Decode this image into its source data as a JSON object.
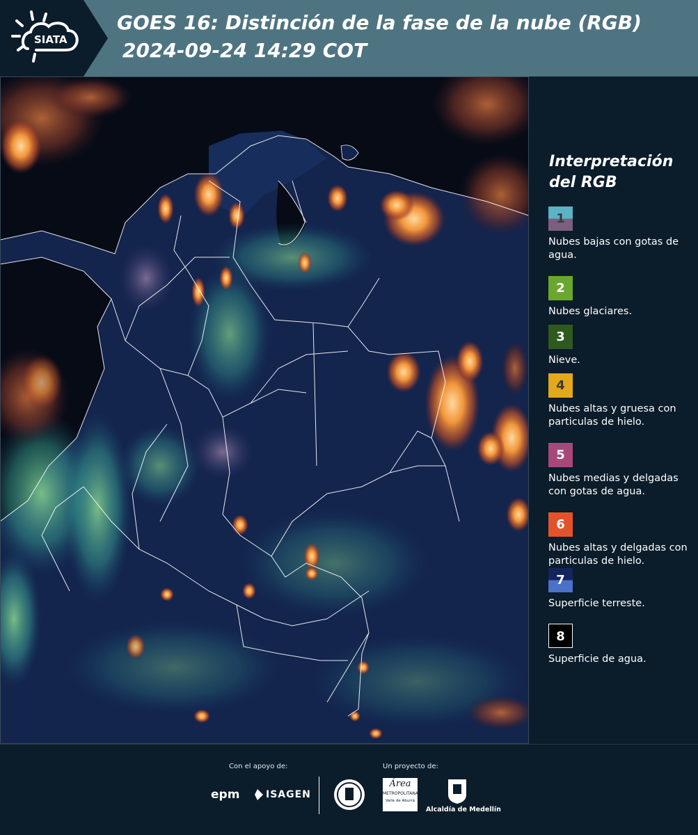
{
  "header": {
    "logo_text": "SIATA",
    "title_line1": "GOES 16: Distinción de la fase de la nube (RGB)",
    "title_line2": "2024-09-24 14:29 COT"
  },
  "legend": {
    "title_line1": "Interpretación",
    "title_line2": "del RGB",
    "items": [
      {
        "num": "1",
        "label": "Nubes bajas con gotas de agua.",
        "color_top": "#5bb4c4",
        "color_bottom": "#7a5f80",
        "text_color": "#3b3b3b"
      },
      {
        "num": "2",
        "label": "Nubes glaciares.",
        "color": "#6aa72f",
        "text_color": "#ffffff"
      },
      {
        "num": "3",
        "label": "Nieve.",
        "color": "#2e5a20",
        "text_color": "#ffffff"
      },
      {
        "num": "4",
        "label": "Nubes altas y gruesa con particulas de hielo.",
        "color": "#e3a81b",
        "text_color": "#3b3b3b"
      },
      {
        "num": "5",
        "label": "Nubes medias y delgadas con gotas de agua.",
        "color": "#a8487a",
        "text_color": "#ffffff"
      },
      {
        "num": "6",
        "label": "Nubes altas y delgadas con particulas de hielo.",
        "color": "#e2532c",
        "text_color": "#ffffff"
      },
      {
        "num": "7",
        "label": "Superficie terreste.",
        "color_top": "#16245e",
        "color_bottom": "#4a72c8",
        "text_color": "#ffffff"
      },
      {
        "num": "8",
        "label": "Superficie de agua.",
        "color": "#000000",
        "text_color": "#ffffff"
      }
    ]
  },
  "footer": {
    "support_label": "Con el apoyo de:",
    "project_label": "Un proyecto de:",
    "epm": "epm",
    "isagen": "ISAGEN",
    "area_metro": "Área",
    "area_metro_sub": "METROPOLITANA",
    "area_metro_sub2": "Valle de Aburrá",
    "alcaldia": "Alcaldía de Medellín"
  },
  "colors": {
    "header_bg": "#4f7481",
    "page_bg": "#0b1c2a",
    "ocean": "#060b16",
    "land": "#13244d"
  }
}
